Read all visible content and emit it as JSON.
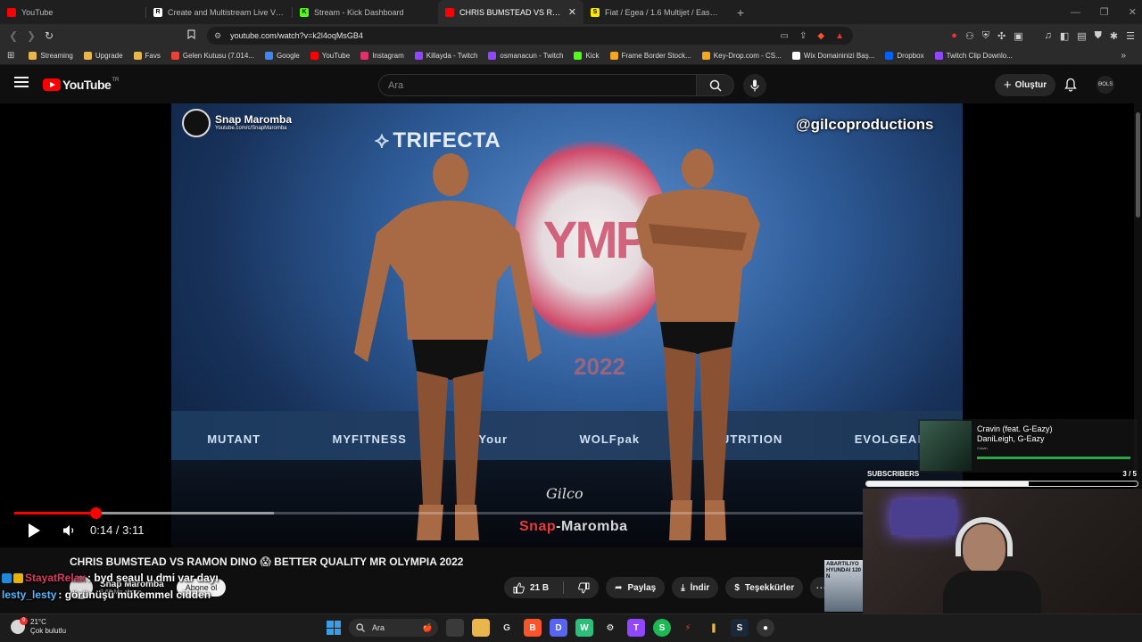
{
  "tabs": [
    {
      "title": "YouTube",
      "icon": "youtube-icon",
      "color": "#ff0000"
    },
    {
      "title": "Create and Multistream Live Video | R",
      "icon": "restream-icon",
      "color": "#ffffff"
    },
    {
      "title": "Stream - Kick Dashboard",
      "icon": "kick-icon",
      "color": "#53fc18"
    },
    {
      "title": "CHRIS BUMSTEAD VS RAMON D",
      "icon": "youtube-icon",
      "color": "#ff0000",
      "active": true
    },
    {
      "title": "Fiat / Egea / 1.6 Multijet / Easy Stil / S",
      "icon": "sahibinden-icon",
      "color": "#ffe800"
    }
  ],
  "address": {
    "url": "youtube.com/watch?v=k2l4oqMsGB4"
  },
  "bookmarks": [
    {
      "label": "Streaming",
      "color": "#e8b64a"
    },
    {
      "label": "Upgrade",
      "color": "#e8b64a"
    },
    {
      "label": "Favs",
      "color": "#e8b64a"
    },
    {
      "label": "Gelen Kutusu (7.014...",
      "color": "#ea4335"
    },
    {
      "label": "Google",
      "color": "#4285f4"
    },
    {
      "label": "YouTube",
      "color": "#ff0000"
    },
    {
      "label": "Instagram",
      "color": "#e1306c"
    },
    {
      "label": "Killayda - Twitch",
      "color": "#9146ff"
    },
    {
      "label": "osmanacun - Twitch",
      "color": "#9146ff"
    },
    {
      "label": "Kick",
      "color": "#53fc18"
    },
    {
      "label": "Frame Border Stock...",
      "color": "#f5a623"
    },
    {
      "label": "Key-Drop.com - CS...",
      "color": "#f5a623"
    },
    {
      "label": "Wix Domaininizi Baş...",
      "color": "#ffffff"
    },
    {
      "label": "Dropbox",
      "color": "#0061ff"
    },
    {
      "label": "Twitch Clip Downlo...",
      "color": "#9146ff"
    }
  ],
  "youtube": {
    "logo_text": "YouTube",
    "country": "TR",
    "search_placeholder": "Ara",
    "create_label": "Oluştur",
    "avatar_text": "ƏOLS"
  },
  "video": {
    "overlay_channel": "Snap Maromba",
    "overlay_url": "Youtube.com/c/SnapMaromba",
    "overlay_handle": "@gilcoproductions",
    "sponsor": "TRIFECTA",
    "stage_word": "YMP",
    "stage_year": "2022",
    "signature": "Gilco",
    "watermark_snap": "Snap",
    "watermark_rest": "-Maromba",
    "sponsors": [
      "MUTANT",
      "MYFITNESS",
      "Your",
      "WOLFpak",
      "NUTRITION",
      "EVOLGEAR"
    ],
    "current_time": "0:14",
    "duration": "3:11",
    "played_fraction": 0.073,
    "buffered_fraction": 0.235
  },
  "meta": {
    "title": "CHRIS BUMSTEAD VS RAMON DINO 😱 BETTER QUALITY MR OLYMPIA 2022",
    "channel": "Snap Maromba",
    "subscribers": "3,62 Mn abone",
    "subscribe_label": "Abone ol",
    "likes": "21 B",
    "share": "Paylaş",
    "download": "İndir",
    "thanks": "Teşekkürler",
    "ad_text": "ABARTILIYO HYUNDAI 120 N"
  },
  "chat": [
    {
      "user": "StayatRelax",
      "message": ": byd seaul u dmi var dayı",
      "color": "#e0385a"
    },
    {
      "user": "lesty_lesty",
      "message": ": görünüşü mükemmel cidden",
      "color": "#5ab6ff"
    }
  ],
  "music": {
    "song": "Cravin (feat. G-Eazy)",
    "artist": "DaniLeigh, G-Eazy",
    "album": "Cravin"
  },
  "subs_goal": {
    "label": "SUBSCRIBERS",
    "count": "3 / 5",
    "fraction": 0.6
  },
  "taskbar": {
    "temperature": "21°C",
    "condition": "Çok bulutlu",
    "weather_badge": "9",
    "search_label": "Ara"
  }
}
